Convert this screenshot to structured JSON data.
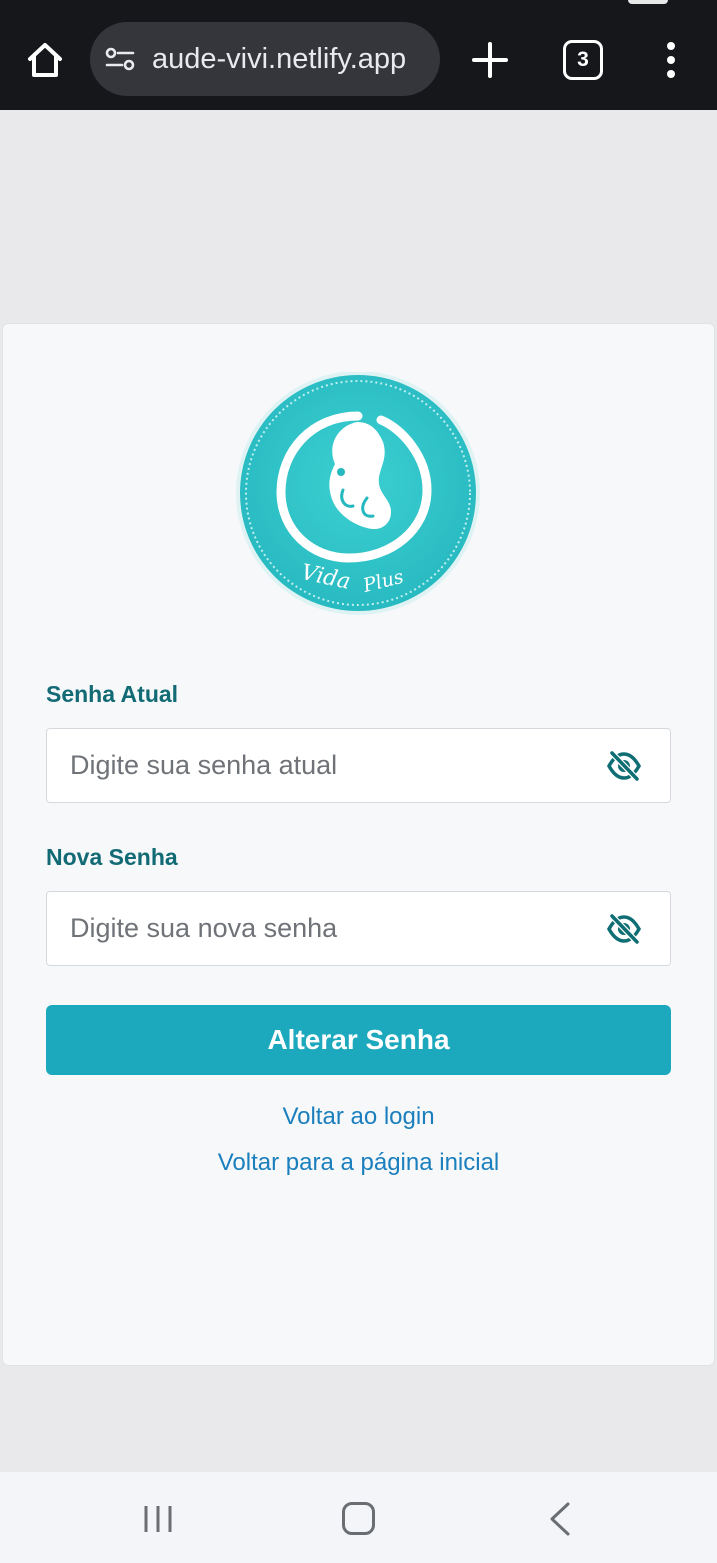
{
  "browser": {
    "url": "aude-vivi.netlify.app",
    "tab_count": "3"
  },
  "form": {
    "current_password": {
      "label": "Senha Atual",
      "placeholder": "Digite sua senha atual",
      "value": ""
    },
    "new_password": {
      "label": "Nova Senha",
      "placeholder": "Digite sua nova senha",
      "value": ""
    },
    "submit_label": "Alterar Senha"
  },
  "links": {
    "back_to_login": "Voltar ao login",
    "back_to_home": "Voltar para a página inicial"
  },
  "logo": {
    "text": "Vida Plus"
  },
  "colors": {
    "accent": "#1ca8bd",
    "label": "#116a74",
    "link": "#1b7fbe",
    "logo_teal": "#2ec4c9"
  },
  "icons": {
    "browser_home": "home-icon",
    "site_settings": "site-settings-icon",
    "new_tab": "plus-icon",
    "menu": "more-vertical-icon",
    "password_toggle": "eye-off-icon",
    "nav_recents": "recents-icon",
    "nav_home": "nav-home-icon",
    "nav_back": "back-icon"
  }
}
